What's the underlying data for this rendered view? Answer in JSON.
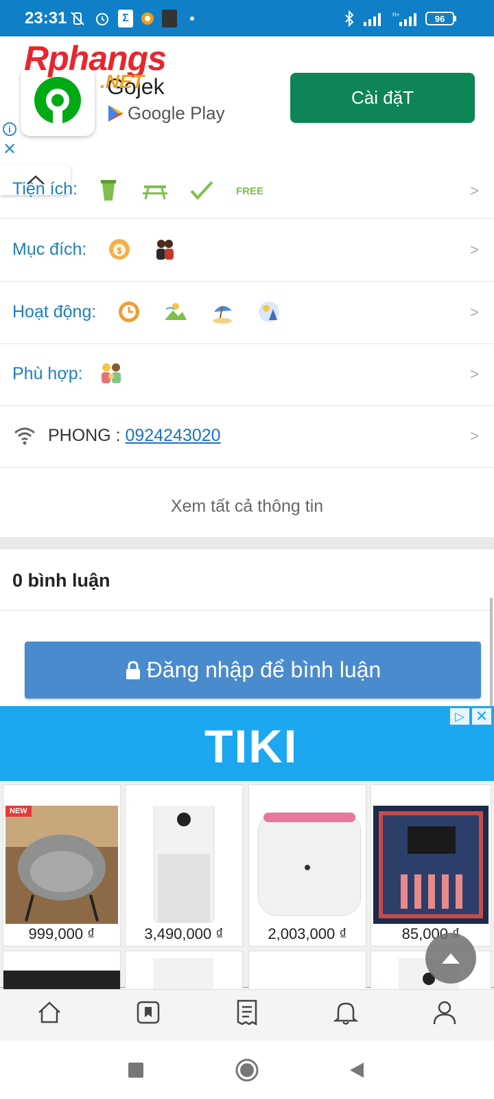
{
  "status_bar": {
    "time": "23:31",
    "battery": "96"
  },
  "top_ad": {
    "watermark": "Rphangs",
    "watermark_suffix": ".NET",
    "app_name": "Gojek",
    "store": "Google Play",
    "install_label": "Cài đặT"
  },
  "info_rows": [
    {
      "label": "Tiện ích:",
      "icons": [
        "drink-icon",
        "picnic-table-icon",
        "checkmark-pen-icon",
        "free-badge-icon"
      ]
    },
    {
      "label": "Mục đích:",
      "icons": [
        "money-bag-icon",
        "couple-icon"
      ]
    },
    {
      "label": "Hoạt động:",
      "icons": [
        "clock-icon",
        "scenery-icon",
        "beach-icon",
        "night-icon"
      ]
    },
    {
      "label": "Phù hợp:",
      "icons": [
        "family-icon"
      ]
    }
  ],
  "contact": {
    "label": "PHONG : ",
    "phone": "0924243020"
  },
  "see_all": "Xem tất cả thông tin",
  "comments": {
    "title": "0 bình luận",
    "login_button": "Đăng nhập để bình luận"
  },
  "tiki_ad": {
    "brand": "TIKI",
    "products": [
      {
        "price": "999,000 ₫",
        "badge": "NEW",
        "image": "chair-image"
      },
      {
        "price": "3,490,000 ₫",
        "image": "air-purifier-image"
      },
      {
        "price": "2,003,000 ₫",
        "image": "sharp-purifier-image"
      },
      {
        "price": "85,000 ₫",
        "image": "hand-cream-box-image"
      }
    ]
  },
  "bottom_nav": [
    "home-icon",
    "bookmark-icon",
    "receipt-icon",
    "bell-icon",
    "profile-icon"
  ]
}
